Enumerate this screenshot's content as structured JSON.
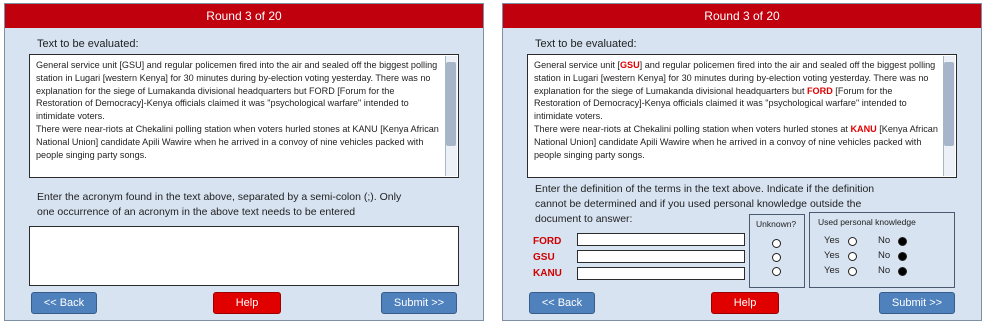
{
  "left": {
    "header": "Round 3 of 20",
    "text_label": "Text to be evaluated:",
    "paragraph1": "General service unit [GSU] and regular policemen  fired into the air and sealed off the biggest polling station in  Lugari [western Kenya] for 30 minutes during by-election voting yesterday. There was no explanation for the siege of Lumakanda divisional headquarters but FORD [Forum for the Restoration of  Democracy]-Kenya officials claimed it was \"psychological warfare\" intended to intimidate voters.",
    "paragraph2": "There were near-riots at Chekalini polling station when voters hurled stones at KANU [Kenya African National Union]  candidate Apili  Wawire when he arrived  in a convoy of nine vehicles packed with people singing party songs.",
    "instruction_line1": "Enter the acronym found in the text above, separated by a semi-colon (;).  Only",
    "instruction_line2": "one occurrence of an acronym in the above text needs to be entered",
    "back_label": "<< Back",
    "help_label": "Help",
    "submit_label": "Submit >>"
  },
  "right": {
    "header": "Round 3 of 20",
    "text_label": "Text to be evaluated:",
    "p1_a": "General service unit [",
    "p1_gsu": "GSU",
    "p1_b": "] and regular policemen  fired into the air and sealed off the biggest polling station in  Lugari [western Kenya] for 30 minutes during by-election voting yesterday. There was no explanation for the siege of Lumakanda divisional headquarters but ",
    "p1_ford": "FORD",
    "p1_c": " [Forum for the Restoration of  Democracy]-Kenya officials claimed it was \"psychological warfare\" intended to intimidate voters.",
    "p2_a": "There were near-riots at Chekalini polling station when voters hurled stones at ",
    "p2_kanu": "KANU",
    "p2_b": " [Kenya African National Union]  candidate Apili  Wawire when he arrived  in a convoy of nine vehicles packed with people singing party songs.",
    "instruction_line1": "Enter the definition of the terms in the text above.  Indicate if the definition",
    "instruction_line2": "cannot be determined  and if you used personal knowledge outside the",
    "instruction_line3": "document to answer:",
    "terms": [
      "FORD",
      "GSU",
      "KANU"
    ],
    "unknown_title": "Unknown?",
    "knowledge_title": "Used personal knowledge",
    "yes_label": "Yes",
    "no_label": "No",
    "back_label": "<< Back",
    "help_label": "Help",
    "submit_label": "Submit >>"
  },
  "colors": {
    "header_red": "#c0000c",
    "term_red": "#e00000",
    "button_blue": "#4f81bd",
    "panel_bg": "#d7e3f1"
  }
}
